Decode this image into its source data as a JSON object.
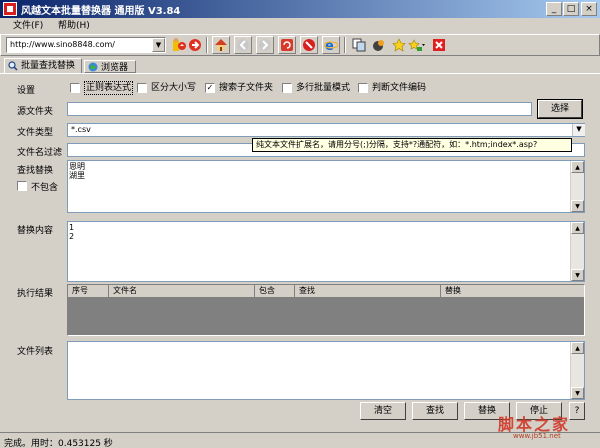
{
  "window": {
    "title": "风越文本批量替换器 通用版 V3.84",
    "minimize": "_",
    "maximize": "□",
    "close": "×"
  },
  "menu": {
    "items": [
      {
        "label": "文件(F)"
      },
      {
        "label": "帮助(H)"
      }
    ]
  },
  "toolbar": {
    "url_value": "http://www.sino8848.com/",
    "icons": [
      "user-go-icon",
      "home-icon",
      "back-icon",
      "forward-icon",
      "refresh-icon",
      "stop-icon",
      "ie-icon",
      "copy-icon",
      "paint-icon",
      "star-icon",
      "add-star-icon",
      "delete-icon"
    ]
  },
  "tabs": [
    {
      "label": "批量查找替换",
      "icon": "search-icon",
      "active": true
    },
    {
      "label": "浏览器",
      "icon": "globe-icon",
      "active": false
    }
  ],
  "settings": {
    "label": "设置",
    "options": [
      {
        "label": "正则表达式",
        "checked": false
      },
      {
        "label": "区分大小写",
        "checked": false
      },
      {
        "label": "搜索子文件夹",
        "checked": true
      },
      {
        "label": "多行批量模式",
        "checked": false
      },
      {
        "label": "判断文件编码",
        "checked": false
      }
    ]
  },
  "source_folder": {
    "label": "源文件夹",
    "value": "",
    "browse_label": "选择"
  },
  "file_type": {
    "label": "文件类型",
    "value": "*.csv",
    "tooltip": "纯文本文件扩展名，请用分号(;)分隔，支持*?通配符，如：*.htm;index*.asp?"
  },
  "filename_filter": {
    "label": "文件名过滤",
    "value": ""
  },
  "find": {
    "label": "查找替换",
    "not_contain_label": "不包含",
    "not_contain_checked": false,
    "lines": [
      "恩明",
      "湖里"
    ]
  },
  "replace": {
    "label": "替换内容",
    "lines": [
      "1",
      "2"
    ]
  },
  "results": {
    "label": "执行结果",
    "columns": [
      "序号",
      "文件名",
      "包含",
      "查找",
      "替换"
    ]
  },
  "file_list": {
    "label": "文件列表"
  },
  "buttons": {
    "clear": "清空",
    "find": "查找",
    "replace": "替换",
    "stop": "停止",
    "help": "?"
  },
  "status": {
    "text": "完成。用时：0.453125 秒"
  },
  "watermark": {
    "text": "脚本之家",
    "sub": "www.jb51.net"
  },
  "colors": {
    "title_start": "#0a246a",
    "title_end": "#a6caf0",
    "results_body": "#808080"
  }
}
